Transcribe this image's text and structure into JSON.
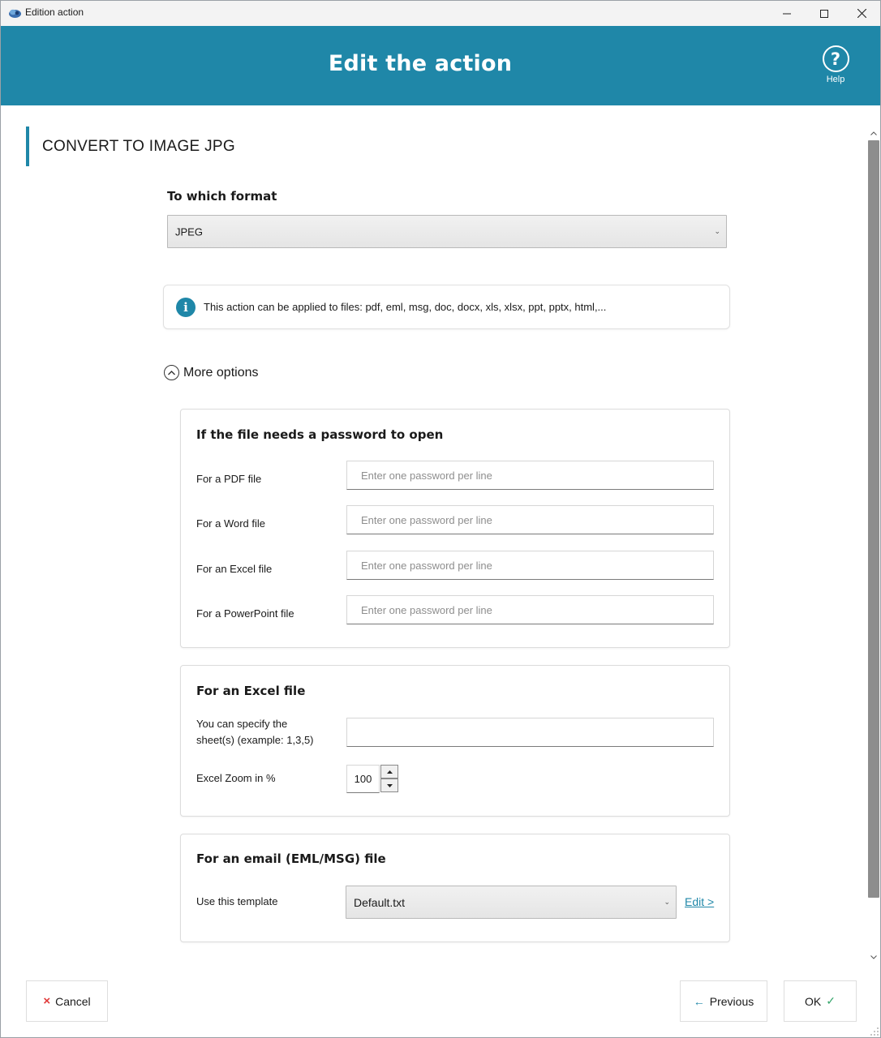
{
  "window": {
    "title": "Edition action"
  },
  "header": {
    "title": "Edit the action",
    "help_label": "Help"
  },
  "section": {
    "title": "CONVERT TO IMAGE JPG"
  },
  "format": {
    "label": "To which format",
    "selected": "JPEG"
  },
  "info": {
    "text": "This action can be applied to files: pdf, eml, msg, doc, docx, xls, xlsx, ppt, pptx, html,..."
  },
  "more_options": {
    "label": "More options"
  },
  "password_group": {
    "title": "If the file needs a password to open",
    "rows": [
      {
        "label": "For a PDF file",
        "placeholder": "Enter one password per line",
        "value": ""
      },
      {
        "label": "For a Word file",
        "placeholder": "Enter one password per line",
        "value": ""
      },
      {
        "label": "For an Excel file",
        "placeholder": "Enter one password per line",
        "value": ""
      },
      {
        "label": "For a PowerPoint file",
        "placeholder": "Enter one password per line",
        "value": ""
      }
    ]
  },
  "excel_group": {
    "title": "For an Excel file",
    "sheets_label_line1": "You can specify the",
    "sheets_label_line2": "sheet(s) (example: 1,3,5)",
    "sheets_value": "",
    "zoom_label": "Excel Zoom in %",
    "zoom_value": "100"
  },
  "email_group": {
    "title": "For an email (EML/MSG) file",
    "template_label": "Use this template",
    "template_selected": "Default.txt",
    "edit_link": "Edit >"
  },
  "footer": {
    "cancel_label": "Cancel",
    "previous_label": "Previous",
    "ok_label": "OK"
  },
  "colors": {
    "brand": "#1f87a8",
    "cancel_icon": "#e03a3a",
    "ok_check": "#35a66b"
  }
}
